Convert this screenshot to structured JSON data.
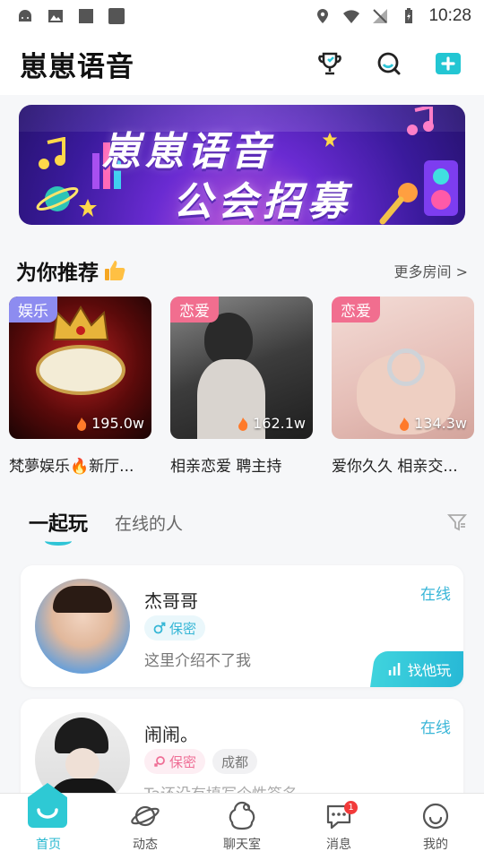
{
  "status_bar": {
    "time": "10:28"
  },
  "header": {
    "title": "崽崽语音"
  },
  "banner": {
    "line1": "崽崽语音",
    "line2": "公会招募"
  },
  "recommend": {
    "title": "为你推荐",
    "more_label": "更多房间 >",
    "rooms": [
      {
        "tag": "娱乐",
        "heat": "195.0w",
        "name": "梵夢娱乐🔥新厅...",
        "tag_color": "#8d8cf0",
        "cover_bg": "#3a1010"
      },
      {
        "tag": "恋爱",
        "heat": "162.1w",
        "name": "相亲恋爱 聘主持",
        "tag_color": "#f16e8f",
        "cover_bg": "#3a3a3a"
      },
      {
        "tag": "恋爱",
        "heat": "134.3w",
        "name": "爱你久久 相亲交...",
        "tag_color": "#f16e8f",
        "cover_bg": "#e9c8c3"
      }
    ]
  },
  "tabs": [
    {
      "label": "一起玩",
      "active": true
    },
    {
      "label": "在线的人",
      "active": false
    }
  ],
  "users": [
    {
      "name": "杰哥哥",
      "gender": "male",
      "gender_label": "保密",
      "city": "",
      "bio": "这里介绍不了我",
      "status": "在线",
      "action": "找他玩"
    },
    {
      "name": "闹闹。",
      "gender": "female",
      "gender_label": "保密",
      "city": "成都",
      "bio": "Ta还没有填写个性签名~",
      "status": "在线",
      "action": ""
    }
  ],
  "bottom_nav": [
    {
      "label": "首页",
      "icon": "home-icon",
      "active": true
    },
    {
      "label": "动态",
      "icon": "planet-icon",
      "active": false
    },
    {
      "label": "聊天室",
      "icon": "chatroom-icon",
      "active": false
    },
    {
      "label": "消息",
      "icon": "message-icon",
      "active": false,
      "badge": "1"
    },
    {
      "label": "我的",
      "icon": "smile-icon",
      "active": false
    }
  ],
  "colors": {
    "accent": "#27b8d6",
    "pink": "#f16e8f",
    "purple": "#6a2bd2"
  }
}
